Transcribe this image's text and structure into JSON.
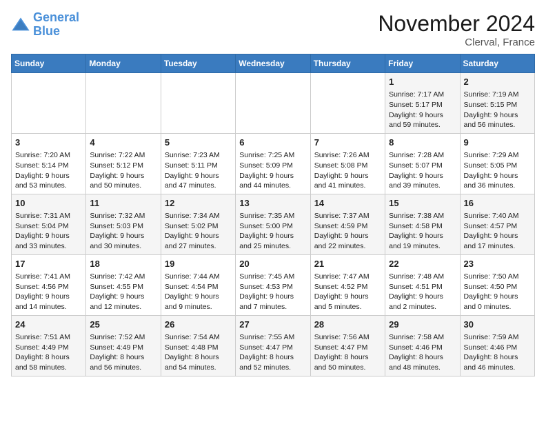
{
  "header": {
    "logo_line1": "General",
    "logo_line2": "Blue",
    "month": "November 2024",
    "location": "Clerval, France"
  },
  "weekdays": [
    "Sunday",
    "Monday",
    "Tuesday",
    "Wednesday",
    "Thursday",
    "Friday",
    "Saturday"
  ],
  "weeks": [
    [
      {
        "day": "",
        "info": ""
      },
      {
        "day": "",
        "info": ""
      },
      {
        "day": "",
        "info": ""
      },
      {
        "day": "",
        "info": ""
      },
      {
        "day": "",
        "info": ""
      },
      {
        "day": "1",
        "info": "Sunrise: 7:17 AM\nSunset: 5:17 PM\nDaylight: 9 hours and 59 minutes."
      },
      {
        "day": "2",
        "info": "Sunrise: 7:19 AM\nSunset: 5:15 PM\nDaylight: 9 hours and 56 minutes."
      }
    ],
    [
      {
        "day": "3",
        "info": "Sunrise: 7:20 AM\nSunset: 5:14 PM\nDaylight: 9 hours and 53 minutes."
      },
      {
        "day": "4",
        "info": "Sunrise: 7:22 AM\nSunset: 5:12 PM\nDaylight: 9 hours and 50 minutes."
      },
      {
        "day": "5",
        "info": "Sunrise: 7:23 AM\nSunset: 5:11 PM\nDaylight: 9 hours and 47 minutes."
      },
      {
        "day": "6",
        "info": "Sunrise: 7:25 AM\nSunset: 5:09 PM\nDaylight: 9 hours and 44 minutes."
      },
      {
        "day": "7",
        "info": "Sunrise: 7:26 AM\nSunset: 5:08 PM\nDaylight: 9 hours and 41 minutes."
      },
      {
        "day": "8",
        "info": "Sunrise: 7:28 AM\nSunset: 5:07 PM\nDaylight: 9 hours and 39 minutes."
      },
      {
        "day": "9",
        "info": "Sunrise: 7:29 AM\nSunset: 5:05 PM\nDaylight: 9 hours and 36 minutes."
      }
    ],
    [
      {
        "day": "10",
        "info": "Sunrise: 7:31 AM\nSunset: 5:04 PM\nDaylight: 9 hours and 33 minutes."
      },
      {
        "day": "11",
        "info": "Sunrise: 7:32 AM\nSunset: 5:03 PM\nDaylight: 9 hours and 30 minutes."
      },
      {
        "day": "12",
        "info": "Sunrise: 7:34 AM\nSunset: 5:02 PM\nDaylight: 9 hours and 27 minutes."
      },
      {
        "day": "13",
        "info": "Sunrise: 7:35 AM\nSunset: 5:00 PM\nDaylight: 9 hours and 25 minutes."
      },
      {
        "day": "14",
        "info": "Sunrise: 7:37 AM\nSunset: 4:59 PM\nDaylight: 9 hours and 22 minutes."
      },
      {
        "day": "15",
        "info": "Sunrise: 7:38 AM\nSunset: 4:58 PM\nDaylight: 9 hours and 19 minutes."
      },
      {
        "day": "16",
        "info": "Sunrise: 7:40 AM\nSunset: 4:57 PM\nDaylight: 9 hours and 17 minutes."
      }
    ],
    [
      {
        "day": "17",
        "info": "Sunrise: 7:41 AM\nSunset: 4:56 PM\nDaylight: 9 hours and 14 minutes."
      },
      {
        "day": "18",
        "info": "Sunrise: 7:42 AM\nSunset: 4:55 PM\nDaylight: 9 hours and 12 minutes."
      },
      {
        "day": "19",
        "info": "Sunrise: 7:44 AM\nSunset: 4:54 PM\nDaylight: 9 hours and 9 minutes."
      },
      {
        "day": "20",
        "info": "Sunrise: 7:45 AM\nSunset: 4:53 PM\nDaylight: 9 hours and 7 minutes."
      },
      {
        "day": "21",
        "info": "Sunrise: 7:47 AM\nSunset: 4:52 PM\nDaylight: 9 hours and 5 minutes."
      },
      {
        "day": "22",
        "info": "Sunrise: 7:48 AM\nSunset: 4:51 PM\nDaylight: 9 hours and 2 minutes."
      },
      {
        "day": "23",
        "info": "Sunrise: 7:50 AM\nSunset: 4:50 PM\nDaylight: 9 hours and 0 minutes."
      }
    ],
    [
      {
        "day": "24",
        "info": "Sunrise: 7:51 AM\nSunset: 4:49 PM\nDaylight: 8 hours and 58 minutes."
      },
      {
        "day": "25",
        "info": "Sunrise: 7:52 AM\nSunset: 4:49 PM\nDaylight: 8 hours and 56 minutes."
      },
      {
        "day": "26",
        "info": "Sunrise: 7:54 AM\nSunset: 4:48 PM\nDaylight: 8 hours and 54 minutes."
      },
      {
        "day": "27",
        "info": "Sunrise: 7:55 AM\nSunset: 4:47 PM\nDaylight: 8 hours and 52 minutes."
      },
      {
        "day": "28",
        "info": "Sunrise: 7:56 AM\nSunset: 4:47 PM\nDaylight: 8 hours and 50 minutes."
      },
      {
        "day": "29",
        "info": "Sunrise: 7:58 AM\nSunset: 4:46 PM\nDaylight: 8 hours and 48 minutes."
      },
      {
        "day": "30",
        "info": "Sunrise: 7:59 AM\nSunset: 4:46 PM\nDaylight: 8 hours and 46 minutes."
      }
    ]
  ]
}
